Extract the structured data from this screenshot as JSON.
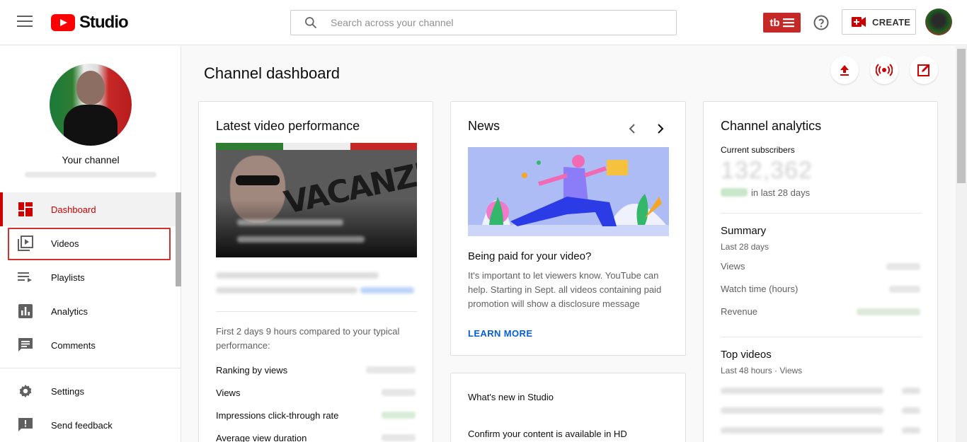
{
  "topbar": {
    "logo_text": "Studio",
    "search_placeholder": "Search across your channel",
    "badge_text": "tb",
    "create_label": "CREATE"
  },
  "sidebar": {
    "channel_label": "Your channel",
    "items": [
      {
        "label": "Dashboard"
      },
      {
        "label": "Videos"
      },
      {
        "label": "Playlists"
      },
      {
        "label": "Analytics"
      },
      {
        "label": "Comments"
      },
      {
        "label": "Settings"
      },
      {
        "label": "Send feedback"
      }
    ]
  },
  "main": {
    "title": "Channel dashboard"
  },
  "latest_video": {
    "title": "Latest video performance",
    "thumb_text": "VACANZE",
    "compare_text": "First 2 days 9 hours compared to your typical performance:",
    "rows": [
      "Ranking by views",
      "Views",
      "Impressions click-through rate",
      "Average view duration"
    ]
  },
  "news": {
    "title": "News",
    "headline": "Being paid for your video?",
    "body": "It's important to let viewers know. YouTube can help. Starting in Sept. all videos containing paid promotion will show a disclosure message",
    "learn_more": "LEARN MORE"
  },
  "whats_new": {
    "title": "What's new in Studio",
    "item1": "Confirm your content is available in HD"
  },
  "analytics": {
    "title": "Channel analytics",
    "subscribers_label": "Current subscribers",
    "subscribers_value": "132,362",
    "period_text": "in last 28 days",
    "summary_title": "Summary",
    "summary_period": "Last 28 days",
    "summary_rows": [
      "Views",
      "Watch time (hours)",
      "Revenue"
    ],
    "top_videos_title": "Top videos",
    "top_videos_period": "Last 48 hours · Views"
  },
  "colors": {
    "brand_red": "#ff0000",
    "active_red": "#cc0000",
    "link_blue": "#065fd4"
  }
}
